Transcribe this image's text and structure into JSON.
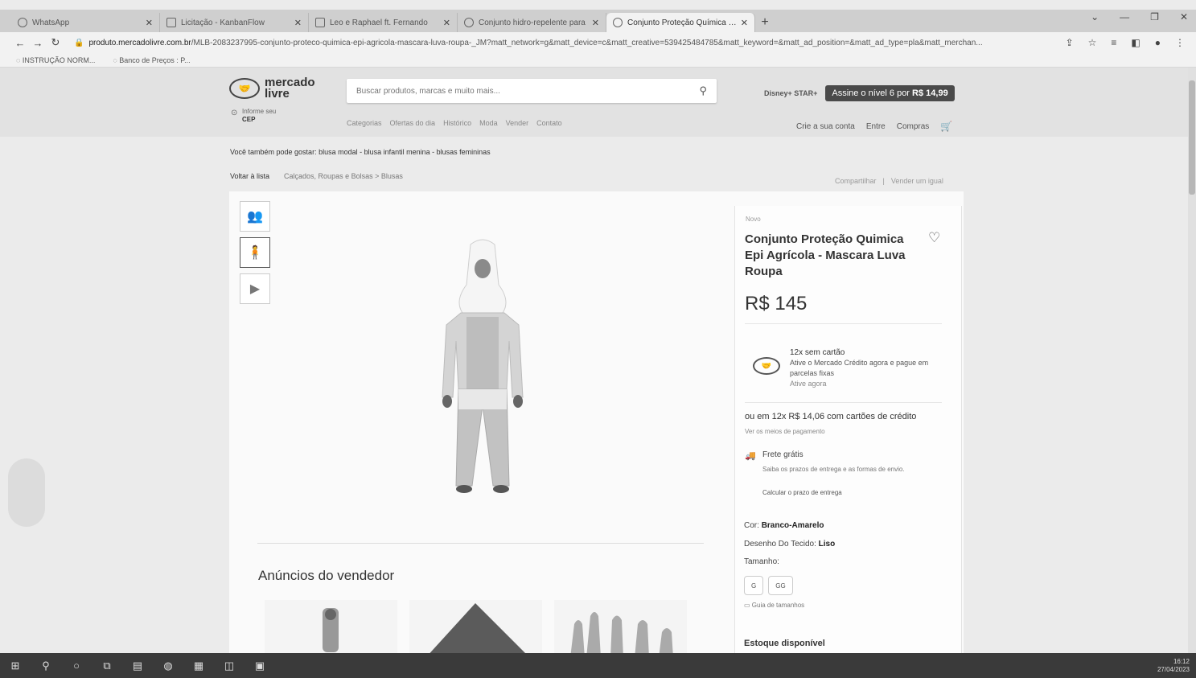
{
  "tabs": [
    {
      "label": "WhatsApp",
      "active": false
    },
    {
      "label": "Licitação - KanbanFlow",
      "active": false
    },
    {
      "label": "Leo e Raphael ft. Fernando",
      "active": false
    },
    {
      "label": "Conjunto hidro-repelente para",
      "active": false
    },
    {
      "label": "Conjunto Proteção Química Epi",
      "active": true
    }
  ],
  "address_bar": {
    "host": "produto.mercadolivre.com.br",
    "path": "/MLB-2083237995-conjunto-proteco-quimica-epi-agricola-mascara-luva-roupa-_JM?matt_network=g&matt_device=c&matt_creative=539425484785&matt_keyword=&matt_ad_position=&matt_ad_type=pla&matt_merchan..."
  },
  "bookmarks": [
    "INSTRUÇÃO NORM...",
    "Banco de Preços : P..."
  ],
  "header": {
    "logo_line1": "mercado",
    "logo_line2": "livre",
    "cep_line1": "Informe seu",
    "cep_line2": "CEP",
    "search_placeholder": "Buscar produtos, marcas e muito mais...",
    "disney_label": "Disney+ STAR+",
    "promo_text": "Assine o nível 6 por",
    "promo_price": "R$ 14,99",
    "nav_links": [
      "Categorias",
      "Ofertas do dia",
      "Histórico",
      "Moda",
      "Vender",
      "Contato"
    ],
    "account_links": [
      "Crie a sua conta",
      "Entre",
      "Compras"
    ]
  },
  "suggestions": "Você também pode gostar: blusa modal - blusa infantil menina - blusas femininas",
  "breadcrumb": {
    "back": "Voltar à lista",
    "path": "Calçados, Roupas e Bolsas > Blusas"
  },
  "share": {
    "share": "Compartilhar",
    "sell": "Vender um igual"
  },
  "product": {
    "condition": "Novo",
    "title": "Conjunto Proteção Quimica Epi Agrícola - Mascara Luva Roupa",
    "price": "R$ 145",
    "credit": {
      "line1": "12x sem cartão",
      "line2": "Ative o Mercado Crédito agora e pague em parcelas fixas",
      "line3": "Ative agora"
    },
    "installments": "ou em 12x R$ 14,06 com cartões de crédito",
    "payment_link": "Ver os meios de pagamento",
    "shipping": {
      "title": "Frete grátis",
      "desc": "Saiba os prazos de entrega e as formas de envio.",
      "calc": "Calcular o prazo de entrega"
    },
    "color_label": "Cor:",
    "color_value": "Branco-Amarelo",
    "fabric_label": "Desenho Do Tecido:",
    "fabric_value": "Liso",
    "size_label": "Tamanho:",
    "sizes": [
      "G",
      "GG"
    ],
    "size_guide": "Guia de tamanhos",
    "stock": "Estoque disponível"
  },
  "seller_section_title": "Anúncios do vendedor",
  "taskbar": {
    "time": "16:12",
    "date": "27/04/2023"
  },
  "colors": {
    "promo_bg": "#4a4a4a",
    "header_bg": "#e2e2e2"
  }
}
